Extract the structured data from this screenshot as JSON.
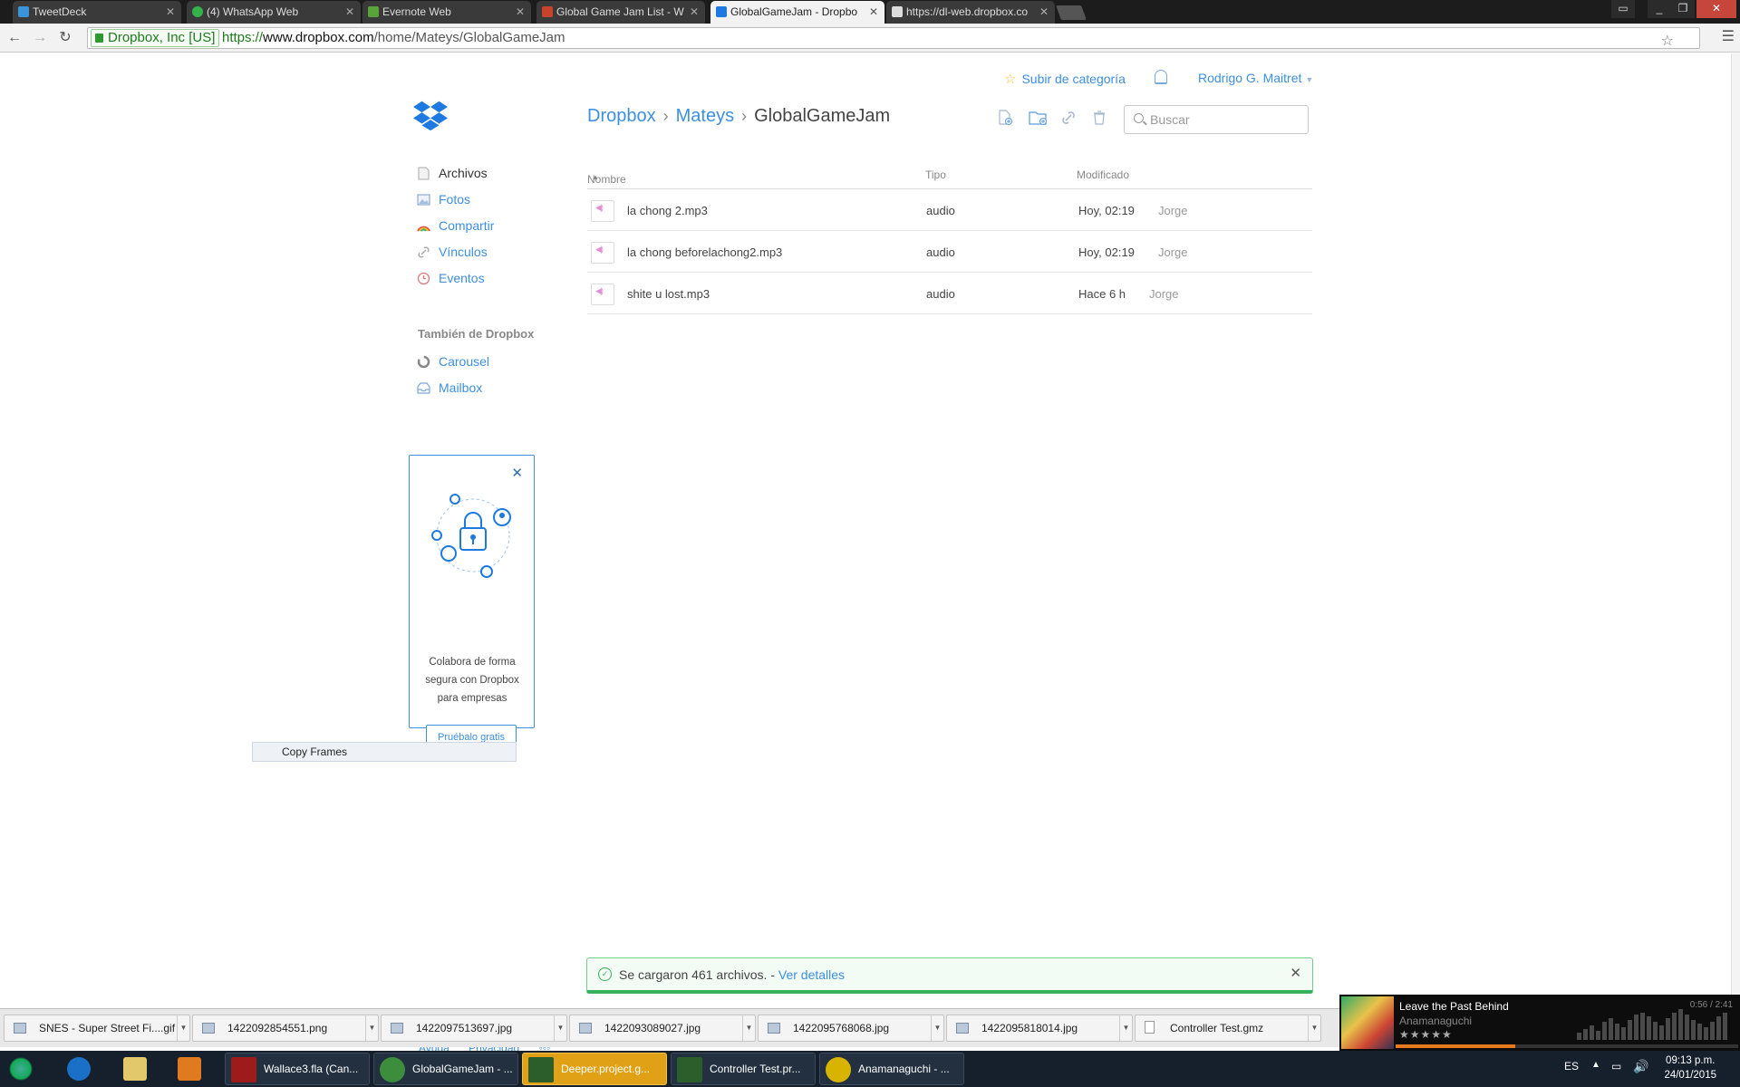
{
  "browser": {
    "tabs": [
      {
        "title": "TweetDeck",
        "color": "#3b94d9"
      },
      {
        "title": "(4) WhatsApp Web",
        "color": "#34b34a"
      },
      {
        "title": "Evernote Web",
        "color": "#5aa33a"
      },
      {
        "title": "Global Game Jam List - W",
        "color": "#c8432d"
      },
      {
        "title": "GlobalGameJam - Dropbo",
        "color": "#1e7ae0"
      },
      {
        "title": "https://dl-web.dropbox.co",
        "color": "#dddddd"
      }
    ],
    "ev_label": "Dropbox, Inc [US]",
    "url_scheme": "https://",
    "url_host": "www.dropbox.com",
    "url_path": "/home/Mateys/GlobalGameJam"
  },
  "header": {
    "upgrade_label": "Subir de categoría",
    "user_name": "Rodrigo G. Maitret"
  },
  "breadcrumb": {
    "root": "Dropbox",
    "parent": "Mateys",
    "current": "GlobalGameJam"
  },
  "search": {
    "placeholder": "Buscar"
  },
  "sidebar": {
    "items": [
      {
        "label": "Archivos",
        "icon": "file-icon"
      },
      {
        "label": "Fotos",
        "icon": "photo-icon"
      },
      {
        "label": "Compartir",
        "icon": "rainbow-icon"
      },
      {
        "label": "Vínculos",
        "icon": "link-icon"
      },
      {
        "label": "Eventos",
        "icon": "clock-icon"
      }
    ],
    "section_title": "También de Dropbox",
    "extra_items": [
      {
        "label": "Carousel",
        "icon": "carousel-icon"
      },
      {
        "label": "Mailbox",
        "icon": "mailbox-icon"
      }
    ]
  },
  "promo": {
    "text": "Colabora de forma segura con Dropbox para empresas",
    "cta": "Pruébalo gratis"
  },
  "context_menu": {
    "item": "Copy Frames"
  },
  "table": {
    "headers": {
      "name": "Nombre",
      "type": "Tipo",
      "modified": "Modificado"
    },
    "rows": [
      {
        "name": "la chong 2.mp3",
        "type": "audio",
        "modified": "Hoy, 02:19",
        "by": "Jorge"
      },
      {
        "name": "la chong beforelachong2.mp3",
        "type": "audio",
        "modified": "Hoy, 02:19",
        "by": "Jorge"
      },
      {
        "name": "shite u lost.mp3",
        "type": "audio",
        "modified": "Hace 6 h",
        "by": "Jorge"
      }
    ]
  },
  "notice": {
    "message": "Se cargaron 461 archivos. -",
    "link": "Ver detalles"
  },
  "footer": {
    "help": "Ayuda",
    "privacy": "Privacidad",
    "more": "◦◦◦"
  },
  "downloads": [
    {
      "name": "SNES - Super Street Fi....gif"
    },
    {
      "name": "1422092854551.png"
    },
    {
      "name": "1422097513697.jpg"
    },
    {
      "name": "1422093089027.jpg"
    },
    {
      "name": "1422095768068.jpg"
    },
    {
      "name": "1422095818014.jpg"
    },
    {
      "name": "Controller Test.gmz"
    }
  ],
  "music": {
    "title": "Leave the Past Behind",
    "artist": "Anamanaguchi",
    "rating_stars": "★★★★★",
    "time": "0:56 / 2:41",
    "progress": 0.35
  },
  "taskbar": {
    "tasks": [
      {
        "label": "Wallace3.fla (Can...",
        "color": "#9e1b1b"
      },
      {
        "label": "GlobalGameJam - ...",
        "color": "#3c8e3c"
      },
      {
        "label": "Deeper.project.g...",
        "color": "#2b5e2b"
      },
      {
        "label": "Controller Test.pr...",
        "color": "#2b5e2b"
      },
      {
        "label": "Anamanaguchi - ...",
        "color": "#d8b400"
      }
    ],
    "lang": "ES",
    "time": "09:13 p.m.",
    "date": "24/01/2015"
  }
}
